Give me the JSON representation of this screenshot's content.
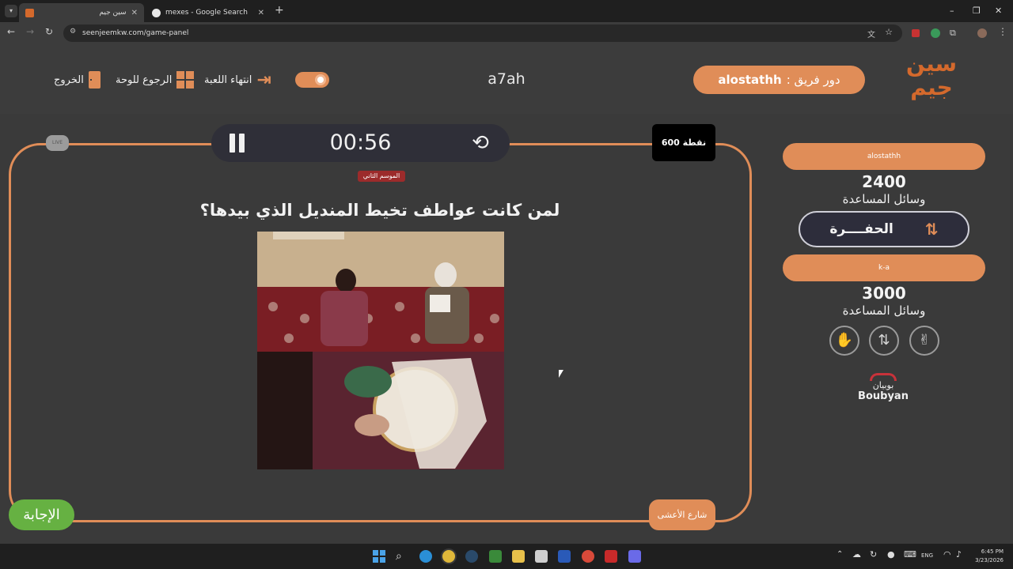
{
  "browser": {
    "tabs": [
      {
        "title": "سين جيم",
        "active": true
      },
      {
        "title": "mexes - Google Search",
        "active": false
      }
    ],
    "url": "seenjeemkw.com/game-panel"
  },
  "header": {
    "logo_text": "سين جيم",
    "turn_prefix": "دور فريق :",
    "turn_team": "alostathh",
    "game_name": "a7ah",
    "end_game_label": "انتهاء اللعبة",
    "back_to_board_label": "الرجوع للوحة",
    "exit_label": "الخروج"
  },
  "board": {
    "timer": "00:56",
    "points": "600 نقطة",
    "corner_badge": "LIVE",
    "season_tag": "الموسم الثاني",
    "question": "لمن كانت عواطف تخيط المنديل الذي بيدها؟",
    "answer_button": "الإجابة",
    "category_label": "شارع الأعشى"
  },
  "teams": [
    {
      "name": "alostathh",
      "score": "2400",
      "aids_label": "وسائل المساعدة",
      "aid": "الحفــــرة"
    },
    {
      "name": "k-a",
      "score": "3000",
      "aids_label": "وسائل المساعدة"
    }
  ],
  "sponsor": {
    "arabic": "بوبيان",
    "latin": "Boubyan"
  },
  "taskbar": {
    "lang": "ENG",
    "time": "6:45 PM",
    "date": "3/23/2026"
  },
  "colors": {
    "accent": "#e08d58",
    "answer_green": "#66b142",
    "header_bg": "#3c3c3c",
    "page_bg": "#3a3a3a"
  }
}
